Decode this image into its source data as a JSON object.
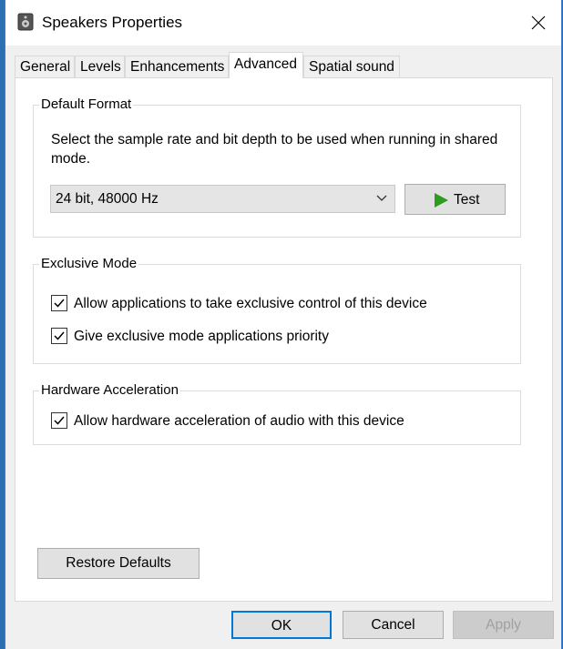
{
  "window": {
    "title": "Speakers Properties"
  },
  "tabs": [
    {
      "label": "General"
    },
    {
      "label": "Levels"
    },
    {
      "label": "Enhancements"
    },
    {
      "label": "Advanced"
    },
    {
      "label": "Spatial sound"
    }
  ],
  "default_format": {
    "legend": "Default Format",
    "description": "Select the sample rate and bit depth to be used when running in shared mode.",
    "selected_format": "24 bit, 48000 Hz",
    "test_label": "Test"
  },
  "exclusive_mode": {
    "legend": "Exclusive Mode",
    "options": [
      {
        "label": "Allow applications to take exclusive control of this device",
        "checked": true
      },
      {
        "label": "Give exclusive mode applications priority",
        "checked": true
      }
    ]
  },
  "hardware_acceleration": {
    "legend": "Hardware Acceleration",
    "options": [
      {
        "label": "Allow hardware acceleration of audio with this device",
        "checked": true
      }
    ]
  },
  "buttons": {
    "restore_defaults": "Restore Defaults",
    "ok": "OK",
    "cancel": "Cancel",
    "apply": "Apply"
  },
  "colors": {
    "accent": "#0078d7",
    "play_icon": "#2e9c1e"
  }
}
